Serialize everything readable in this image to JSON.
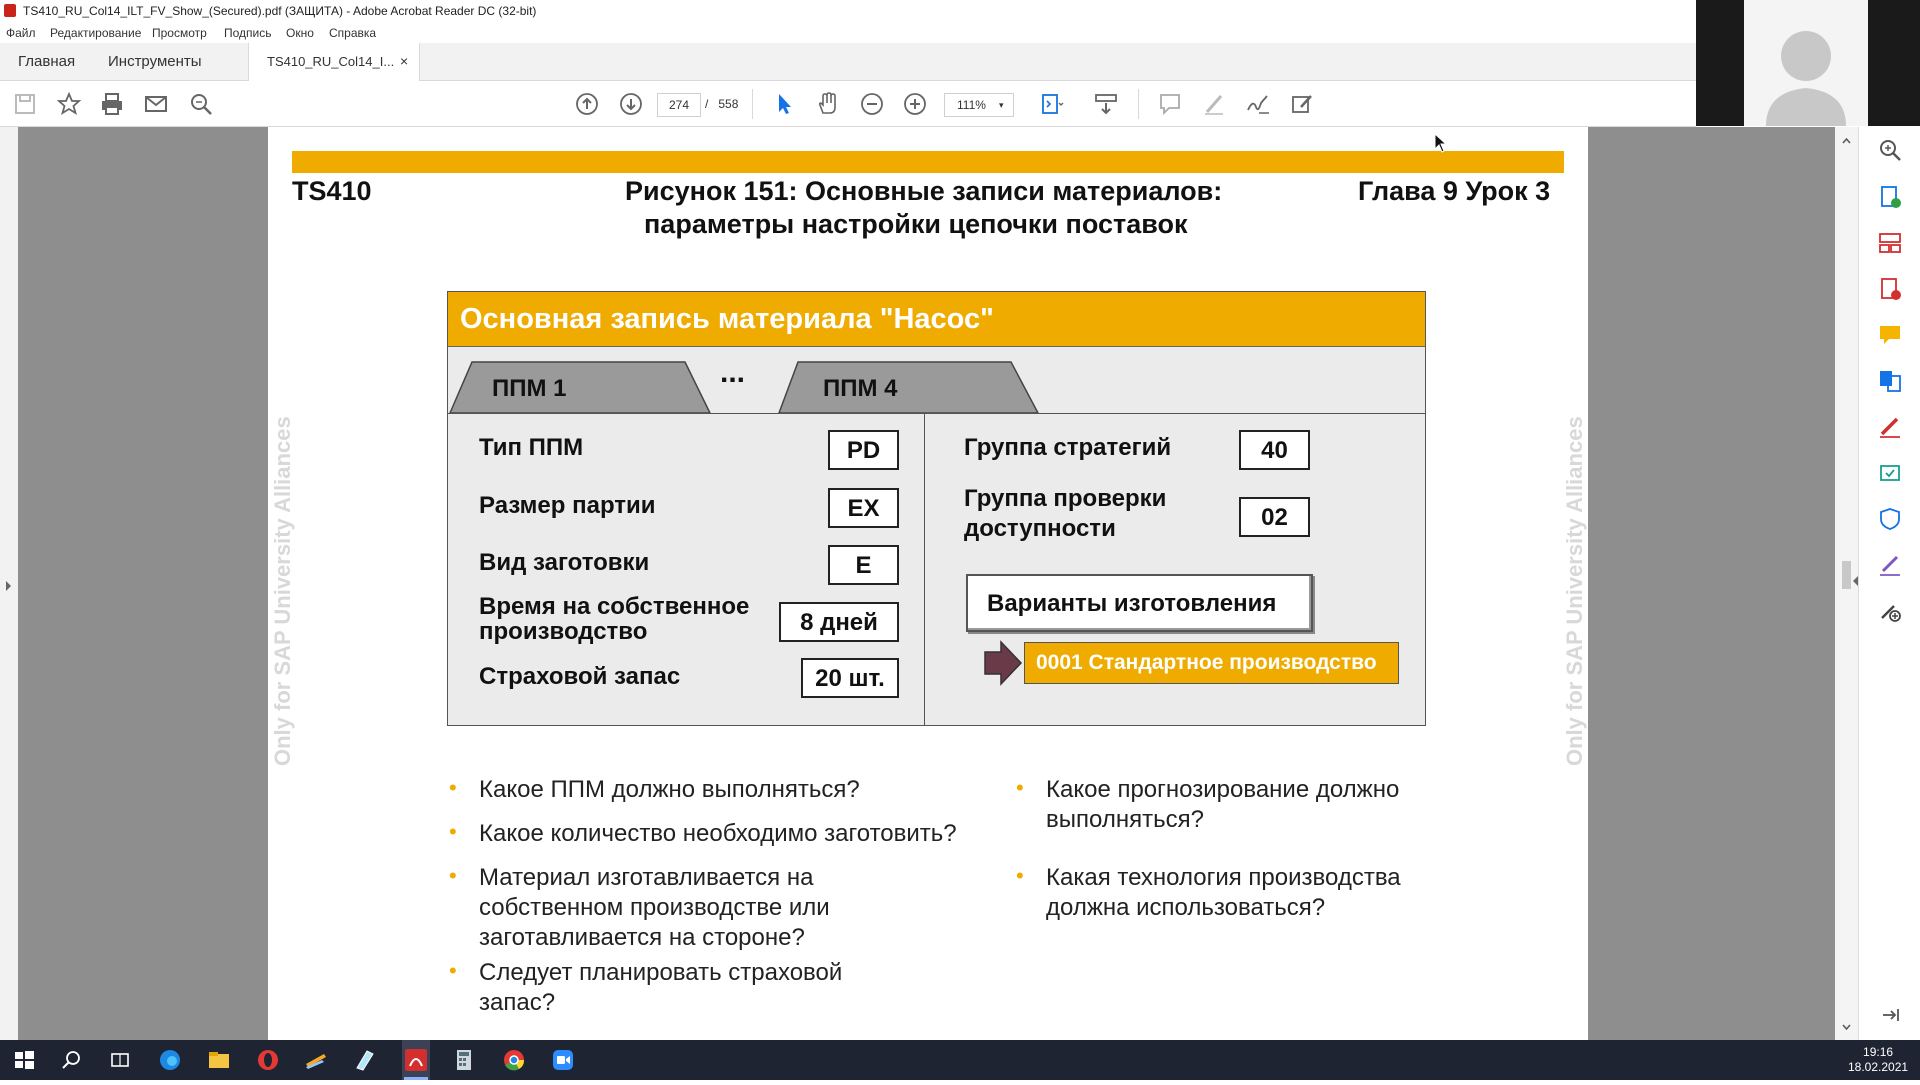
{
  "window": {
    "title": "TS410_RU_Col14_ILT_FV_Show_(Secured).pdf (ЗАЩИТА) - Adobe Acrobat Reader DC (32-bit)"
  },
  "menu": [
    "Файл",
    "Редактирование",
    "Просмотр",
    "Подпись",
    "Окно",
    "Справка"
  ],
  "tabs": {
    "home": "Главная",
    "tools": "Инструменты",
    "document": "TS410_RU_Col14_I...",
    "close": "×"
  },
  "toolbar": {
    "current_page": "274",
    "page_separator": "/",
    "total_pages": "558",
    "zoom": "111%",
    "zoom_caret": "▾"
  },
  "page": {
    "header_left": "TS410",
    "header_center_line1": "Рисунок 151: Основные записи материалов:",
    "header_center_line2": "параметры настройки цепочки поставок",
    "header_right": "Глава 9 Урок 3",
    "watermark": "Only for SAP University Alliances",
    "accent_color": "#f0ab00"
  },
  "diagram": {
    "title": "Основная запись материала \"Насос\"",
    "tab1": "ППМ 1",
    "ellipsis": "...",
    "tab4": "ППМ 4",
    "left_fields": [
      {
        "label": "Тип ППМ",
        "value": "PD"
      },
      {
        "label": "Размер партии",
        "value": "EX"
      },
      {
        "label": "Вид заготовки",
        "value": "E"
      },
      {
        "label": "Время на собственное\nпроизводство",
        "value": "8 дней"
      },
      {
        "label": "Страховой запас",
        "value": "20 шт."
      }
    ],
    "right_fields": [
      {
        "label": "Группа стратегий",
        "value": "40"
      },
      {
        "label": "Группа проверки\nдоступности",
        "value": "02"
      }
    ],
    "variants_button": "Варианты изготовления",
    "standard_production": "0001 Стандартное производство"
  },
  "bullets_left": [
    "Какое ППМ должно выполняться?",
    "Какое количество необходимо заготовить?",
    "Материал изготавливается на собственном производстве или заготавливается на стороне?",
    "Следует планировать страховой запас?"
  ],
  "bullets_right": [
    "Какое прогнозирование должно выполняться?",
    "Какая технология производства должна использоваться?"
  ],
  "taskbar": {
    "time": "19:16",
    "date": "18.02.2021"
  }
}
